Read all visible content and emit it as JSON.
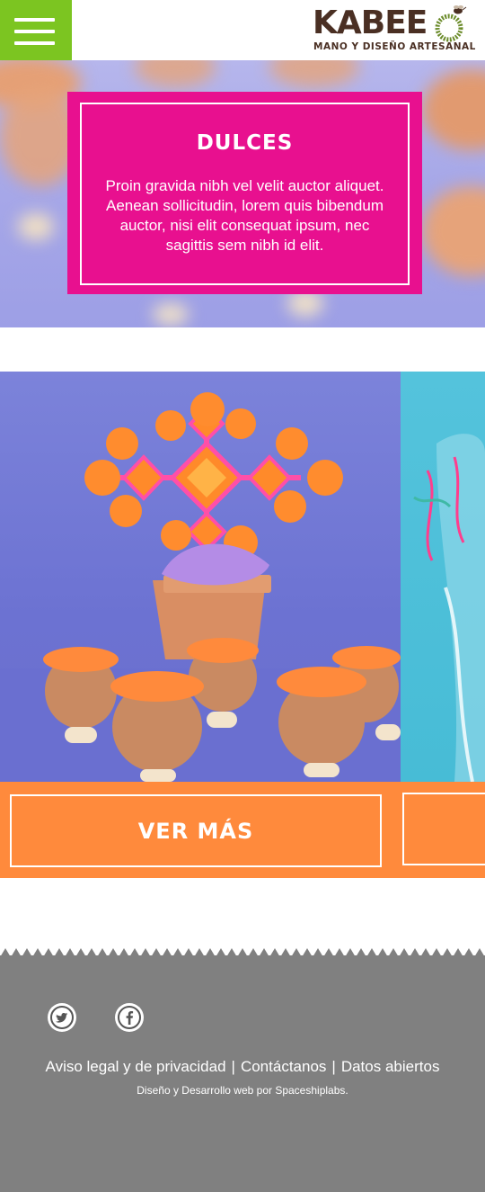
{
  "header": {
    "menu_icon": "hamburger-menu-icon",
    "logo_word": "KABEE",
    "logo_tagline": "MANO Y DISEÑO ARTESANAL"
  },
  "hero": {
    "title": "DULCES",
    "text": "Proin gravida nibh vel velit auctor aliquet. Aenean sollicitudin, lorem quis bibendum auctor, nisi elit consequat ipsum, nec sagittis sem nibh id elit."
  },
  "products": [
    {
      "cta_label": "VER MÁS"
    },
    {
      "cta_label": ""
    }
  ],
  "footer": {
    "social": [
      "twitter-icon",
      "facebook-icon"
    ],
    "links": [
      "Aviso legal y de privacidad",
      "Contáctanos",
      "Datos abiertos"
    ],
    "separator": "|",
    "credit": "Diseño y Desarrollo web por Spaceshiplabs."
  },
  "colors": {
    "menu_green": "#7cc521",
    "brand_pink": "#e8108f",
    "cta_orange": "#ff8a3c",
    "footer_gray": "#808080",
    "logo_brown": "#4a2f23"
  }
}
